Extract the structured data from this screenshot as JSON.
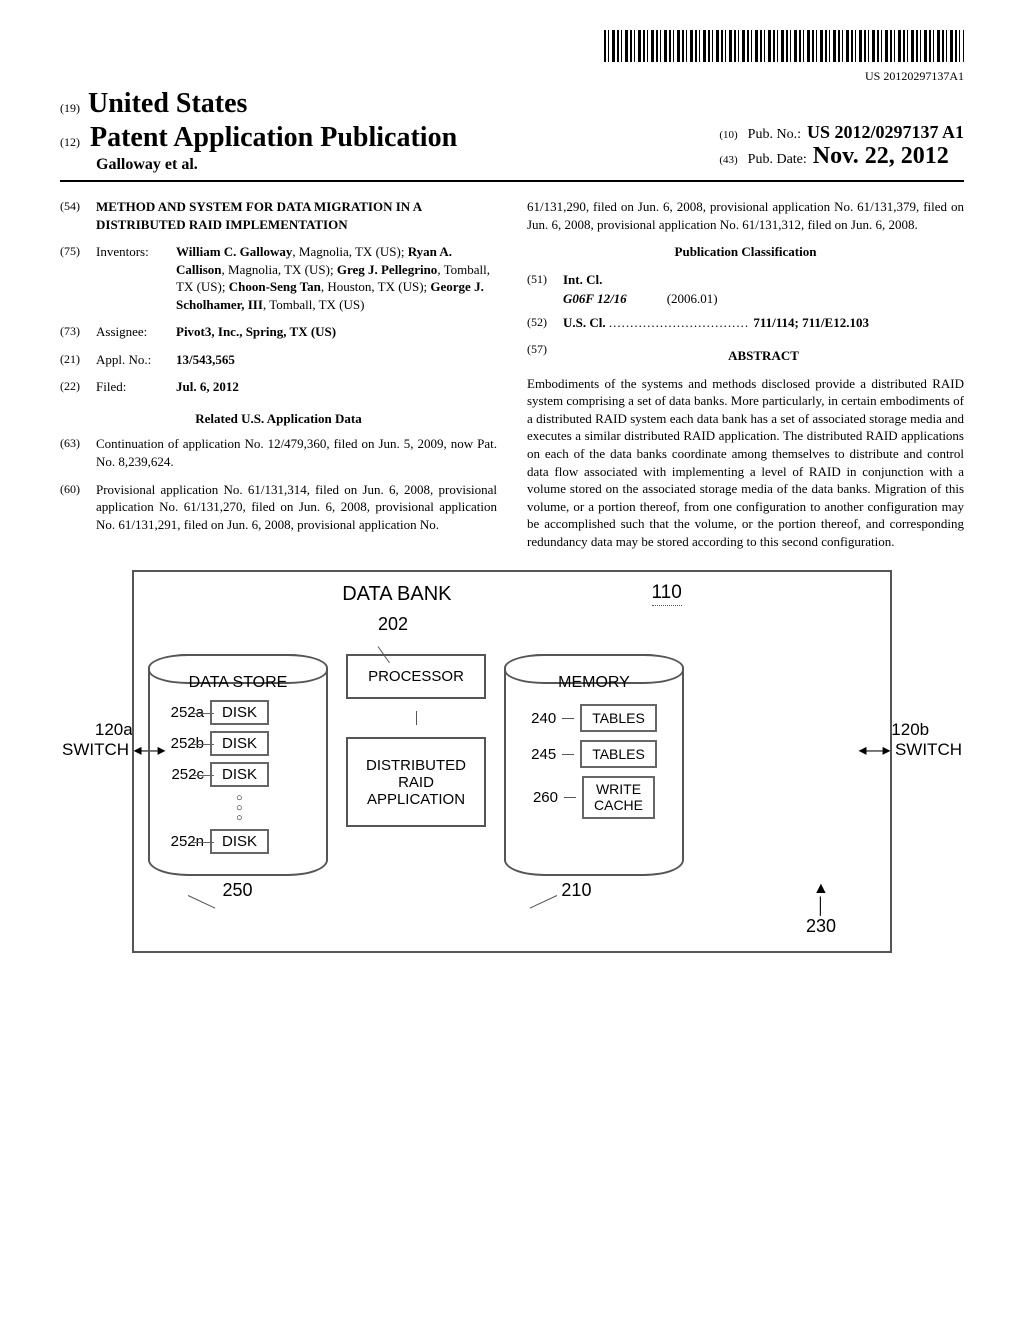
{
  "barcode_text": "US 20120297137A1",
  "country_code": "(19)",
  "country": "United States",
  "pub_type_code": "(12)",
  "pub_type": "Patent Application Publication",
  "authors_line": "Galloway et al.",
  "pub_no_code": "(10)",
  "pub_no_label": "Pub. No.:",
  "pub_no": "US 2012/0297137 A1",
  "pub_date_code": "(43)",
  "pub_date_label": "Pub. Date:",
  "pub_date": "Nov. 22, 2012",
  "title_code": "(54)",
  "title": "METHOD AND SYSTEM FOR DATA MIGRATION IN A DISTRIBUTED RAID IMPLEMENTATION",
  "inventors_code": "(75)",
  "inventors_label": "Inventors:",
  "inventors_value": "William C. Galloway, Magnolia, TX (US); Ryan A. Callison, Magnolia, TX (US); Greg J. Pellegrino, Tomball, TX (US); Choon-Seng Tan, Houston, TX (US); George J. Scholhamer, III, Tomball, TX (US)",
  "assignee_code": "(73)",
  "assignee_label": "Assignee:",
  "assignee_value": "Pivot3, Inc., Spring, TX (US)",
  "appl_code": "(21)",
  "appl_label": "Appl. No.:",
  "appl_value": "13/543,565",
  "filed_code": "(22)",
  "filed_label": "Filed:",
  "filed_value": "Jul. 6, 2012",
  "related_heading": "Related U.S. Application Data",
  "cont_code": "(63)",
  "cont_text": "Continuation of application No. 12/479,360, filed on Jun. 5, 2009, now Pat. No. 8,239,624.",
  "prov_code": "(60)",
  "prov_text": "Provisional application No. 61/131,314, filed on Jun. 6, 2008, provisional application No. 61/131,270, filed on Jun. 6, 2008, provisional application No. 61/131,291, filed on Jun. 6, 2008, provisional application No.",
  "prov_text_cont": "61/131,290, filed on Jun. 6, 2008, provisional application No. 61/131,379, filed on Jun. 6, 2008, provisional application No. 61/131,312, filed on Jun. 6, 2008.",
  "pubclass_heading": "Publication Classification",
  "intcl_code": "(51)",
  "intcl_label": "Int. Cl.",
  "intcl_class": "G06F 12/16",
  "intcl_year": "(2006.01)",
  "uscl_code": "(52)",
  "uscl_label": "U.S. Cl.",
  "uscl_value": "711/114; 711/E12.103",
  "abstract_code": "(57)",
  "abstract_heading": "ABSTRACT",
  "abstract_text": "Embodiments of the systems and methods disclosed provide a distributed RAID system comprising a set of data banks. More particularly, in certain embodiments of a distributed RAID system each data bank has a set of associated storage media and executes a similar distributed RAID application. The distributed RAID applications on each of the data banks coordinate among themselves to distribute and control data flow associated with implementing a level of RAID in conjunction with a volume stored on the associated storage media of the data banks. Migration of this volume, or a portion thereof, from one configuration to another configuration may be accomplished such that the volume, or the portion thereof, and corresponding redundancy data may be stored according to this second configuration.",
  "figure": {
    "title": "DATA BANK",
    "ref_main": "110",
    "datastore_title": "DATA STORE",
    "ref_202": "202",
    "disks": {
      "a": {
        "label": "252a",
        "text": "DISK"
      },
      "b": {
        "label": "252b",
        "text": "DISK"
      },
      "c": {
        "label": "252c",
        "text": "DISK"
      },
      "n": {
        "label": "252n",
        "text": "DISK"
      }
    },
    "processor": "PROCESSOR",
    "app_box": "DISTRIBUTED RAID APPLICATION",
    "ref_210": "210",
    "ref_250": "250",
    "memory_title": "MEMORY",
    "mem": {
      "t1": {
        "label": "240",
        "text": "TABLES"
      },
      "t2": {
        "label": "245",
        "text": "TABLES"
      },
      "wc": {
        "label": "260",
        "text_l1": "WRITE",
        "text_l2": "CACHE"
      }
    },
    "ref_230": "230",
    "left_sw": {
      "ref": "120a",
      "label": "SWITCH"
    },
    "right_sw": {
      "ref": "120b",
      "label": "SWITCH"
    }
  }
}
